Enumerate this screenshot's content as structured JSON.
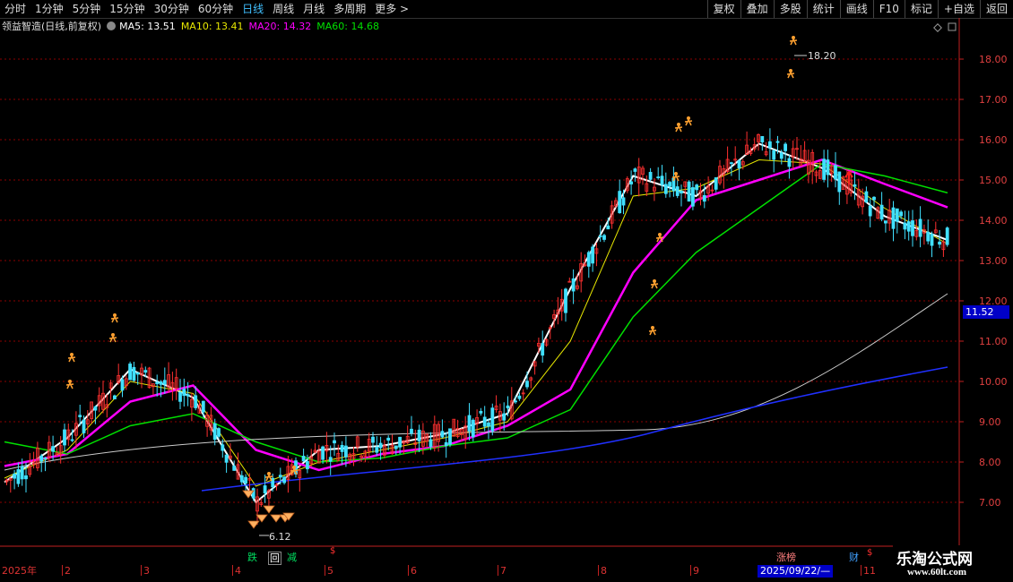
{
  "toolbar": {
    "left": [
      "分时",
      "1分钟",
      "5分钟",
      "15分钟",
      "30分钟",
      "60分钟",
      "日线",
      "周线",
      "月线",
      "多周期",
      "更多 >"
    ],
    "right": [
      "复权",
      "叠加",
      "多股",
      "统计",
      "画线",
      "F10",
      "标记",
      "+自选",
      "返回"
    ]
  },
  "legend": {
    "title": "领益智造(日线,前复权)",
    "ma5": "MA5: 13.51",
    "ma10": "MA10: 13.41",
    "ma20": "MA20: 14.32",
    "ma60": "MA60: 14.68"
  },
  "colors": {
    "ma5": "#ffffff",
    "ma10": "#e6e600",
    "ma20": "#ff00ff",
    "ma60": "#00e000",
    "up": "#ff3030",
    "down": "#40e0ff",
    "grid": "#8b0000",
    "axis": "#c02020"
  },
  "yaxis": {
    "ticks": [
      "18.00",
      "17.00",
      "16.00",
      "15.00",
      "14.00",
      "13.00",
      "12.00",
      "11.00",
      "10.00",
      "9.00",
      "8.00",
      "7.00"
    ]
  },
  "current_price": "11.52",
  "annotations": {
    "high": "18.20",
    "low": "6.12"
  },
  "xaxis": {
    "labels": [
      "2025年",
      "2",
      "3",
      "4",
      "5",
      "6",
      "7",
      "8",
      "9",
      "11"
    ],
    "cursor_date": "2025/09/22/—"
  },
  "signals": {
    "die": "跌",
    "hui": "回",
    "jian": "减",
    "zhang": "涨榜",
    "cai": "财"
  },
  "watermark": {
    "line1": "乐淘公式网",
    "line2": "www.60lt.com"
  },
  "chart_data": {
    "type": "line",
    "title": "领益智造(日线,前复权)",
    "ylim": [
      6.6,
      18.8
    ],
    "grid": true,
    "x": [
      "2025年",
      "2",
      "3",
      "4",
      "5",
      "6",
      "7",
      "8",
      "9",
      "11"
    ],
    "series": [
      {
        "name": "MA5",
        "values": [
          7.5,
          8.6,
          10.3,
          9.6,
          7.0,
          8.3,
          8.4,
          8.7,
          9.2,
          12.3,
          15.1,
          14.6,
          15.9,
          15.3,
          14.1,
          13.51
        ]
      },
      {
        "name": "MA10",
        "values": [
          7.6,
          8.3,
          10.0,
          9.7,
          7.4,
          8.0,
          8.3,
          8.6,
          9.0,
          11.0,
          14.6,
          14.8,
          15.5,
          15.4,
          14.3,
          13.41
        ]
      },
      {
        "name": "MA20",
        "values": [
          7.9,
          8.2,
          9.5,
          9.9,
          8.3,
          7.8,
          8.2,
          8.4,
          8.9,
          9.8,
          12.7,
          14.5,
          15.0,
          15.5,
          14.9,
          14.32
        ]
      },
      {
        "name": "MA60",
        "values": [
          8.5,
          8.2,
          8.9,
          9.2,
          8.5,
          8.0,
          8.1,
          8.4,
          8.6,
          9.3,
          11.6,
          13.2,
          14.3,
          15.4,
          15.1,
          14.68
        ]
      }
    ],
    "annotations": {
      "high": 18.2,
      "low": 6.12
    }
  }
}
